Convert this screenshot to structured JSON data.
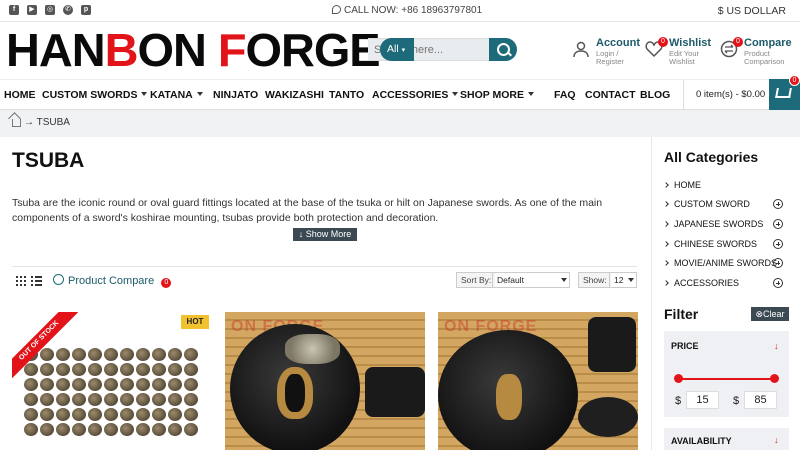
{
  "topbar": {
    "social_icons": [
      "facebook-icon",
      "youtube-icon",
      "instagram-icon",
      "whatsapp-icon",
      "pinterest-icon"
    ],
    "call": "CALL NOW: +86 18963797801",
    "currency": "$ US DOLLAR"
  },
  "header": {
    "logo_parts": [
      "HAN",
      "B",
      "ON ",
      "F",
      "ORGE"
    ],
    "search": {
      "category": "All",
      "placeholder": "Search here..."
    },
    "account": {
      "title": "Account",
      "subtitle": "Login / Register"
    },
    "wishlist": {
      "title": "Wishlist",
      "subtitle": "Edit Your Wishlist",
      "count": "0"
    },
    "compare": {
      "title": "Compare",
      "subtitle": "Product Comparison",
      "count": "0"
    }
  },
  "nav": {
    "items": [
      "HOME",
      "CUSTOM SWORDS",
      "KATANA",
      "NINJATO",
      "WAKIZASHI",
      "TANTO",
      "ACCESSORIES",
      "SHOP MORE",
      "FAQ",
      "CONTACT",
      "BLOG"
    ],
    "cart": "0 item(s) - $0.00",
    "cart_count": "0"
  },
  "breadcrumb": {
    "current": "→ TSUBA"
  },
  "main": {
    "title": "TSUBA",
    "description": "Tsuba are the iconic round or oval guard fittings located at the base of the tsuka or hilt on Japanese swords. As one of the main components of a sword's koshirae mounting, tsubas provide both protection and decoration.",
    "show_more": "Show More",
    "product_compare": "Product Compare",
    "compare_count": "0",
    "sort_label": "Sort By:",
    "sort_value": "Default",
    "show_label": "Show:",
    "show_value": "12"
  },
  "products": {
    "p1_ribbon": "OUT OF STOCK",
    "p1_badge": "HOT",
    "watermark": "ON FORGE"
  },
  "sidebar": {
    "categories_title": "All Categories",
    "categories": [
      "HOME",
      "CUSTOM SWORD",
      "JAPANESE SWORDS",
      "CHINESE SWORDS",
      "MOVIE/ANIME SWORDS",
      "ACCESSORIES"
    ],
    "filter_title": "Filter",
    "clear": "Clear",
    "price_label": "PRICE",
    "currency_symbol": "$",
    "price_min": "15",
    "price_max": "85",
    "availability_label": "AVAILABILITY"
  },
  "colors": {
    "accent": "#1d6b7a",
    "brand_red": "#e3131a",
    "badge_yellow": "#f2c12e"
  }
}
